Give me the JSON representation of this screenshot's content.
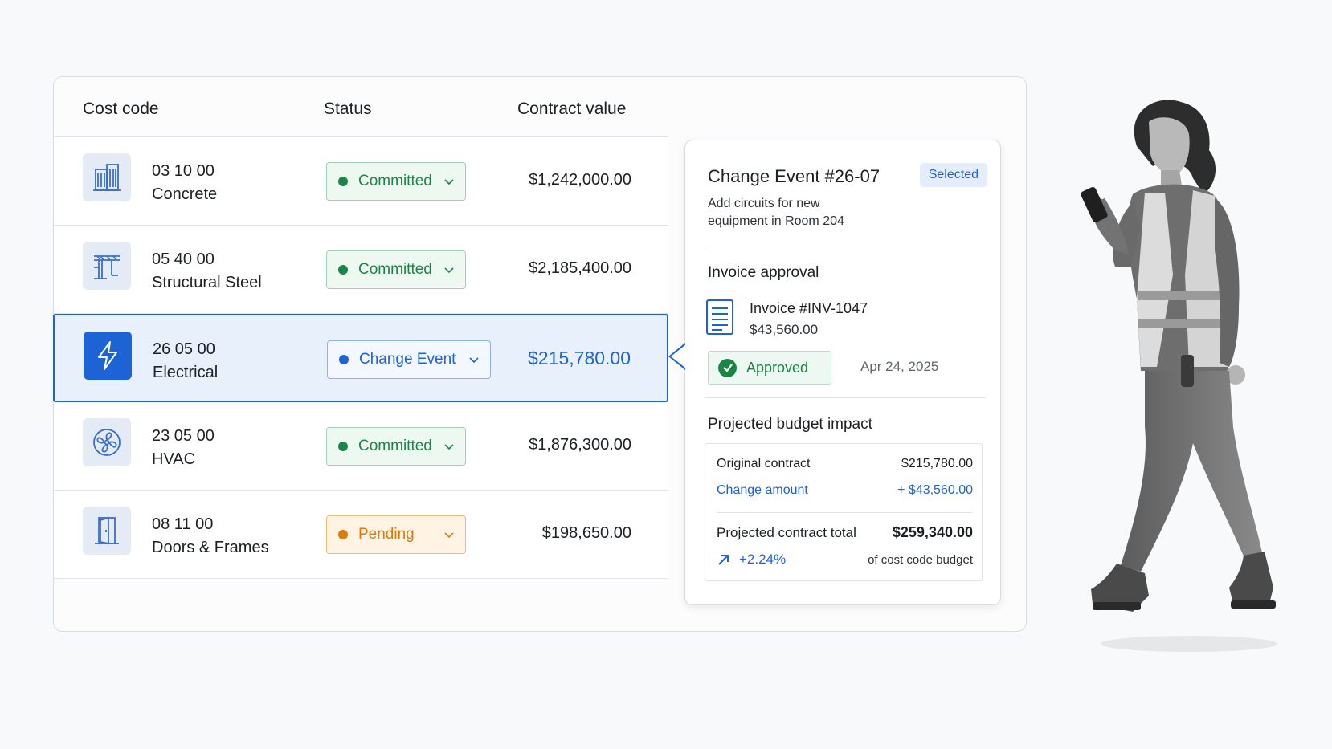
{
  "table": {
    "headers": {
      "cost_code": "Cost code",
      "status": "Status",
      "contract_value": "Contract value"
    },
    "rows": [
      {
        "code": "03 10 00",
        "name": "Concrete",
        "status": "Committed",
        "value": "$1,242,000.00",
        "icon": "building-icon"
      },
      {
        "code": "05 40 00",
        "name": "Structural Steel",
        "status": "Committed",
        "value": "$2,185,400.00",
        "icon": "steel-frame-icon"
      },
      {
        "code": "26 05 00",
        "name": "Electrical",
        "status": "Change Event",
        "value": "$215,780.00",
        "icon": "lightning-icon"
      },
      {
        "code": "23 05 00",
        "name": "HVAC",
        "status": "Committed",
        "value": "$1,876,300.00",
        "icon": "fan-icon"
      },
      {
        "code": "08 11 00",
        "name": "Doors & Frames",
        "status": "Pending",
        "value": "$198,650.00",
        "icon": "door-icon"
      }
    ]
  },
  "panel": {
    "title": "Change Event #26-07",
    "badge": "Selected",
    "description": "Add circuits for new equipment in Room 204",
    "invoice_section": "Invoice approval",
    "invoice_title": "Invoice #INV-1047",
    "invoice_amount": "$43,560.00",
    "approval_status": "Approved",
    "approval_date": "Apr 24, 2025",
    "budget_section": "Projected budget impact",
    "original_label": "Original contract",
    "original_value": "$215,780.00",
    "change_label": "Change amount",
    "change_value": "+ $43,560.00",
    "projected_label": "Projected contract total",
    "projected_value": "$259,340.00",
    "percent": "+2.24%",
    "percent_note": "of cost code budget"
  },
  "colors": {
    "accent": "#1e63d6",
    "committed": "#1a8646",
    "pending": "#dd7a0b"
  }
}
